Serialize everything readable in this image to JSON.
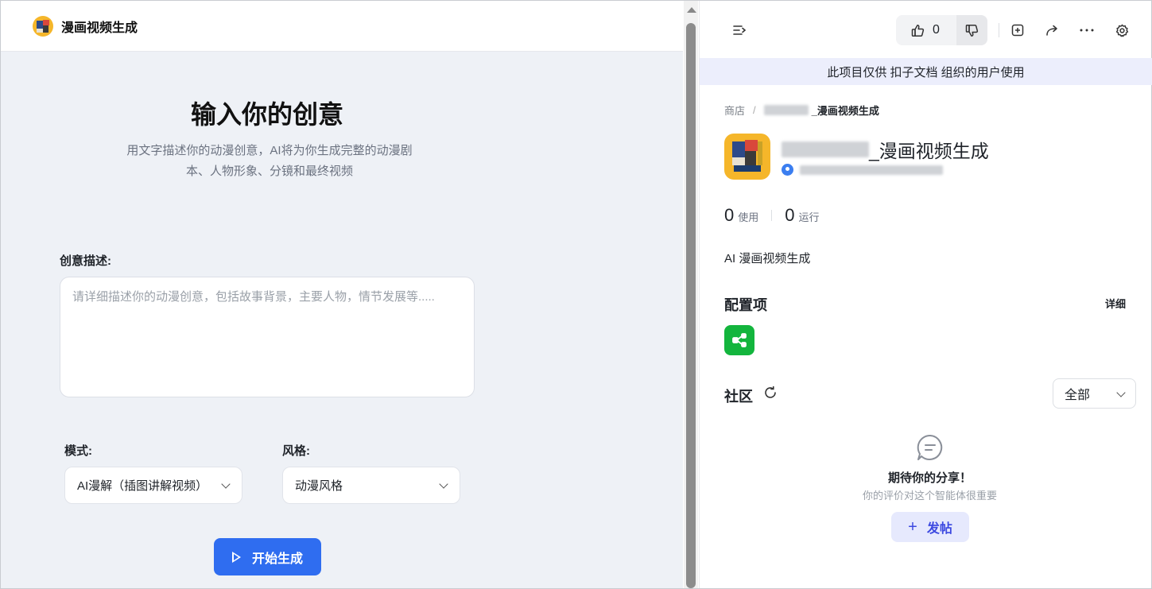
{
  "app": {
    "title": "漫画视频生成",
    "hero_title": "输入你的创意",
    "hero_subtitle": "用文字描述你的动漫创意，AI将为你生成完整的动漫剧本、人物形象、分镜和最终视频",
    "description_label": "创意描述:",
    "description_placeholder": "请详细描述你的动漫创意，包括故事背景，主要人物，情节发展等.....",
    "mode_label": "模式:",
    "mode_value": "AI漫解（插图讲解视频）",
    "style_label": "风格:",
    "style_value": "动漫风格",
    "start_button": "开始生成"
  },
  "panel": {
    "like_count": "0",
    "banner": "此项目仅供 扣子文档 组织的用户使用",
    "breadcrumb": {
      "store": "商店",
      "separator": "/",
      "current": "_漫画视频生成"
    },
    "bot_name": "_漫画视频生成",
    "stats": {
      "usage_count": "0",
      "usage_label": "使用",
      "run_count": "0",
      "run_label": "运行"
    },
    "description": "AI 漫画视频生成",
    "config_title": "配置项",
    "config_detail": "详细",
    "community_title": "社区",
    "community_filter": "全部",
    "empty_title": "期待你的分享！",
    "empty_subtitle": "你的评价对这个智能体很重要",
    "post_button": "发帖"
  },
  "icons": {
    "collapse": "collapse-sidebar-icon",
    "like": "thumbs-up-icon",
    "dislike": "thumbs-down-icon",
    "add": "add-square-icon",
    "share": "share-icon",
    "more": "more-icon",
    "settings": "gear-icon",
    "refresh": "refresh-icon",
    "plugin": "workflow-icon",
    "comment": "comment-icon",
    "play": "play-icon"
  },
  "colors": {
    "primary": "#2f6df0",
    "banner_bg": "#eceefc",
    "post_button": "#3c49e0",
    "plugin_green": "#13b53d",
    "logo_yellow": "#f5b62a"
  }
}
